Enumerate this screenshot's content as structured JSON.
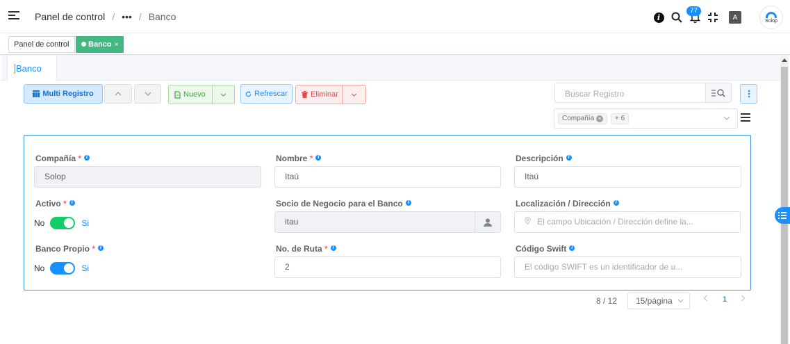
{
  "header": {
    "breadcrumb": {
      "root": "Panel de control",
      "sep1": "/",
      "ellipsis": "•••",
      "sep2": "/",
      "current": "Banco"
    },
    "notification_count": "77",
    "info_glyph": "i",
    "lang_label": "A",
    "logo_text": "Solop",
    "icons": [
      "menu-icon",
      "info-icon",
      "search-icon",
      "bell-icon",
      "fullscreen-icon",
      "language-icon"
    ]
  },
  "tags": [
    {
      "label": "Panel de control",
      "active": false
    },
    {
      "label": "Banco",
      "active": true,
      "close": "×"
    }
  ],
  "tab": {
    "label": "Banco"
  },
  "toolbar": {
    "multi_label": "Multi Registro",
    "new_label": "Nuevo",
    "refresh_label": "Refrescar",
    "delete_label": "Eliminar",
    "search_placeholder": "Buscar Registro",
    "filter_chip": "Compañía",
    "filter_more": "+ 6"
  },
  "form": {
    "company_label": "Compañía",
    "company_value": "Solop",
    "name_label": "Nombre",
    "name_value": "Itaú",
    "description_label": "Descripción",
    "description_value": "Itaú",
    "active_label": "Activo",
    "active_no": "No",
    "active_yes": "Si",
    "partner_label": "Socio de Negocio para el Banco",
    "partner_value": "itau",
    "location_label": "Localización / Dirección",
    "location_placeholder": "El campo Ubicación / Dirección define la...",
    "own_bank_label": "Banco Propio",
    "own_no": "No",
    "own_yes": "Si",
    "routing_label": "No. de Ruta",
    "routing_value": "2",
    "swift_label": "Código Swift",
    "swift_placeholder": "El código SWIFT es un identificador de u...",
    "required_mark": "*",
    "info_mark": "i"
  },
  "pager": {
    "total": "8 / 12",
    "page_size": "15/página",
    "current_page": "1"
  },
  "colors": {
    "accent": "#1890ff",
    "active_tag": "#42b983",
    "switch_green": "#13ce66",
    "switch_blue": "#1890ff"
  }
}
